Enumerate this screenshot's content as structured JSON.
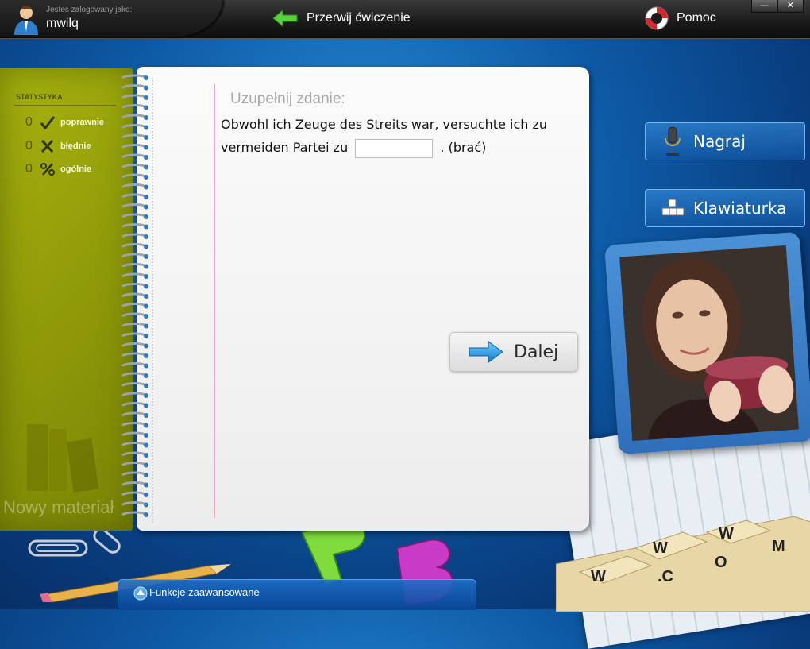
{
  "topbar": {
    "logged_label": "Jesteś zalogowany jako:",
    "username": "mwilq",
    "abort_label": "Przerwij ćwiczenie",
    "help_label": "Pomoc",
    "minimize": "—",
    "close": "✕"
  },
  "stats": {
    "title": "STATYSTYKA",
    "items": [
      {
        "count": "0",
        "label": "poprawnie",
        "icon": "check-icon"
      },
      {
        "count": "0",
        "label": "błędnie",
        "icon": "cross-icon"
      },
      {
        "count": "0",
        "label": "ogólnie",
        "icon": "percent-icon"
      }
    ]
  },
  "cover": {
    "new_material": "Nowy materiał"
  },
  "exercise": {
    "task_label": "Uzupełnij zdanie:",
    "sentence_part1": "Obwohl ich Zeuge des Streits war, versuchte ich zu vermeiden Partei zu",
    "answer_value": "",
    "sentence_part2": ". (brać)",
    "next_label": "Dalej"
  },
  "side": {
    "record_label": "Nagraj",
    "keyboard_label": "Klawiaturka"
  },
  "bottom": {
    "advanced_label": "Funkcje zaawansowane"
  },
  "colors": {
    "cover": "#a7b20f",
    "accent_blue": "#0e5aa6",
    "arrow_green": "#58d23a"
  }
}
